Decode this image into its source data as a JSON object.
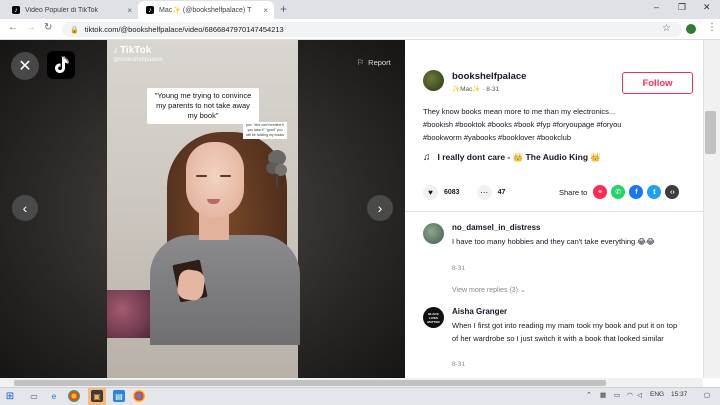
{
  "browser": {
    "tabs": [
      {
        "title": "Video Populer di TikTok",
        "close": "×"
      },
      {
        "title": "Mac✨ (@bookshelfpalace) T",
        "close": "×"
      }
    ],
    "new_tab": "+",
    "url": "tiktok.com/@bookshelfpalace/video/6866847970147454213",
    "window_controls": {
      "minimize": "–",
      "maximize": "❐",
      "close": "✕"
    }
  },
  "video": {
    "watermark_brand": "TikTok",
    "watermark_handle": "@bookshelfpalace",
    "caption": "\"Young me trying to convince my parents to not take away my book\"",
    "small_caption": "pov: \"she can't breathe if you take it\" \"good\" you will be holding my books",
    "report_label": "Report",
    "close_symbol": "✕",
    "prev_symbol": "‹",
    "next_symbol": "›"
  },
  "post": {
    "username": "bookshelfpalace",
    "subline": "✨Mac✨ · 8-31",
    "follow_label": "Follow",
    "description_line1": "They know books mean more to me than my electronics...",
    "description_line2": "#bookish #booktok #books #book #fyp #foryoupage #foryou",
    "description_line3": "#bookworm #yabooks #booklover #bookclub",
    "music": "I really dont care - 👑 The Audio King 👑",
    "likes": "6083",
    "comments": "47",
    "share_label": "Share to"
  },
  "comments": [
    {
      "name": "no_damsel_in_distress",
      "text": "I have too many hobbies and they can't take everything 😂😂",
      "date": "8-31",
      "view_more": "View more replies (3) ⌄"
    },
    {
      "name": "Aisha Granger",
      "avatar_text": "BLACK LIVES MATTER",
      "text": "When I first got into reading my mam took my book and put it on top of her wardrobe so I just switch it with a book that looked similar",
      "date": "8-31"
    }
  ],
  "taskbar": {
    "lang": "ENG",
    "time": "15:37"
  },
  "colors": {
    "accent": "#fe2c55",
    "share_link": "#fe2c55",
    "share_whatsapp": "#25d366",
    "share_facebook": "#1877f2",
    "share_twitter": "#1da1f2",
    "share_embed": "#3d3d3d"
  }
}
